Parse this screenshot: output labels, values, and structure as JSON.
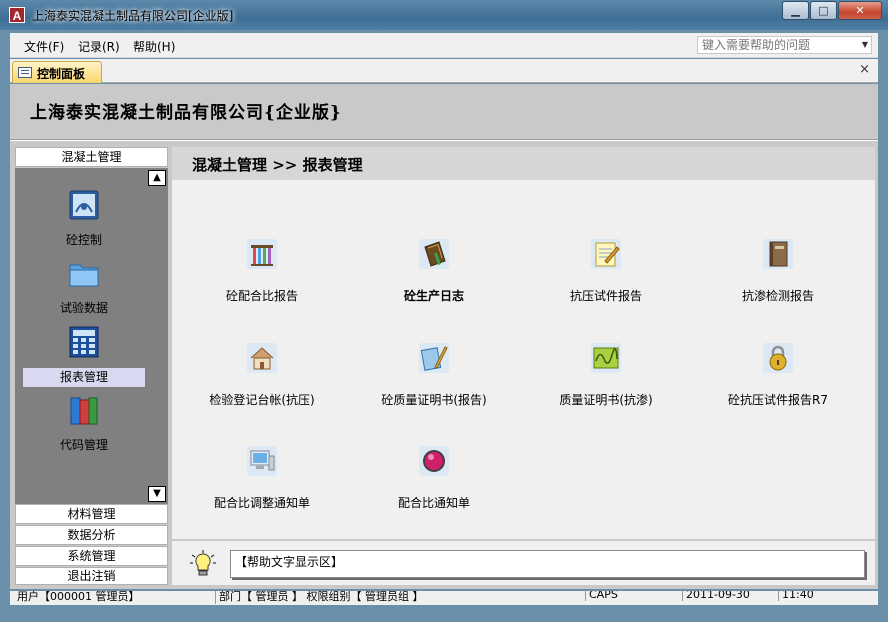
{
  "window": {
    "title": "上海泰实混凝土制品有限公司[企业版]",
    "app_icon_letter": "A",
    "min_glyph": "▁",
    "max_glyph": "□",
    "close_glyph": "✕"
  },
  "menu": {
    "items": [
      "文件(F)",
      "记录(R)",
      "帮助(H)"
    ],
    "help_placeholder": "键入需要帮助的问题"
  },
  "tab": {
    "label": "控制面板",
    "close_glyph": "×"
  },
  "header": {
    "company": "上海泰实混凝土制品有限公司{企业版}"
  },
  "nav": {
    "top_group": "混凝土管理",
    "items": [
      {
        "label": "砼控制",
        "icon": "concrete-control-icon"
      },
      {
        "label": "试验数据",
        "icon": "folder-icon"
      },
      {
        "label": "报表管理",
        "icon": "calculator-icon",
        "selected": true
      },
      {
        "label": "代码管理",
        "icon": "code-books-icon"
      }
    ],
    "bottom_groups": [
      "材料管理",
      "数据分析",
      "系统管理",
      "退出注销"
    ]
  },
  "content": {
    "breadcrumb": "混凝土管理  >> 报表管理",
    "items": [
      {
        "label": "砼配合比报告",
        "icon": "test-tubes-icon"
      },
      {
        "label": "砼生产日志",
        "icon": "log-book-icon",
        "bold": true
      },
      {
        "label": "抗压试件报告",
        "icon": "notepad-icon"
      },
      {
        "label": "抗渗检测报告",
        "icon": "book-icon"
      },
      {
        "label": "检验登记台帐(抗压)",
        "icon": "house-icon"
      },
      {
        "label": "砼质量证明书(报告)",
        "icon": "document-pen-icon"
      },
      {
        "label": "质量证明书(抗渗)",
        "icon": "chart-wave-icon"
      },
      {
        "label": "砼抗压试件报告R7",
        "icon": "padlock-icon"
      },
      {
        "label": "配合比调整通知单",
        "icon": "computer-icon"
      },
      {
        "label": "配合比通知单",
        "icon": "red-ball-icon"
      }
    ]
  },
  "help": {
    "text": "【帮助文字显示区】"
  },
  "status": {
    "user": "用户【000001 管理员】",
    "dept": "部门【 管理员 】 权限组别【 管理员组 】",
    "caps": "CAPS",
    "date": "2011-09-30",
    "time": "11:40"
  }
}
